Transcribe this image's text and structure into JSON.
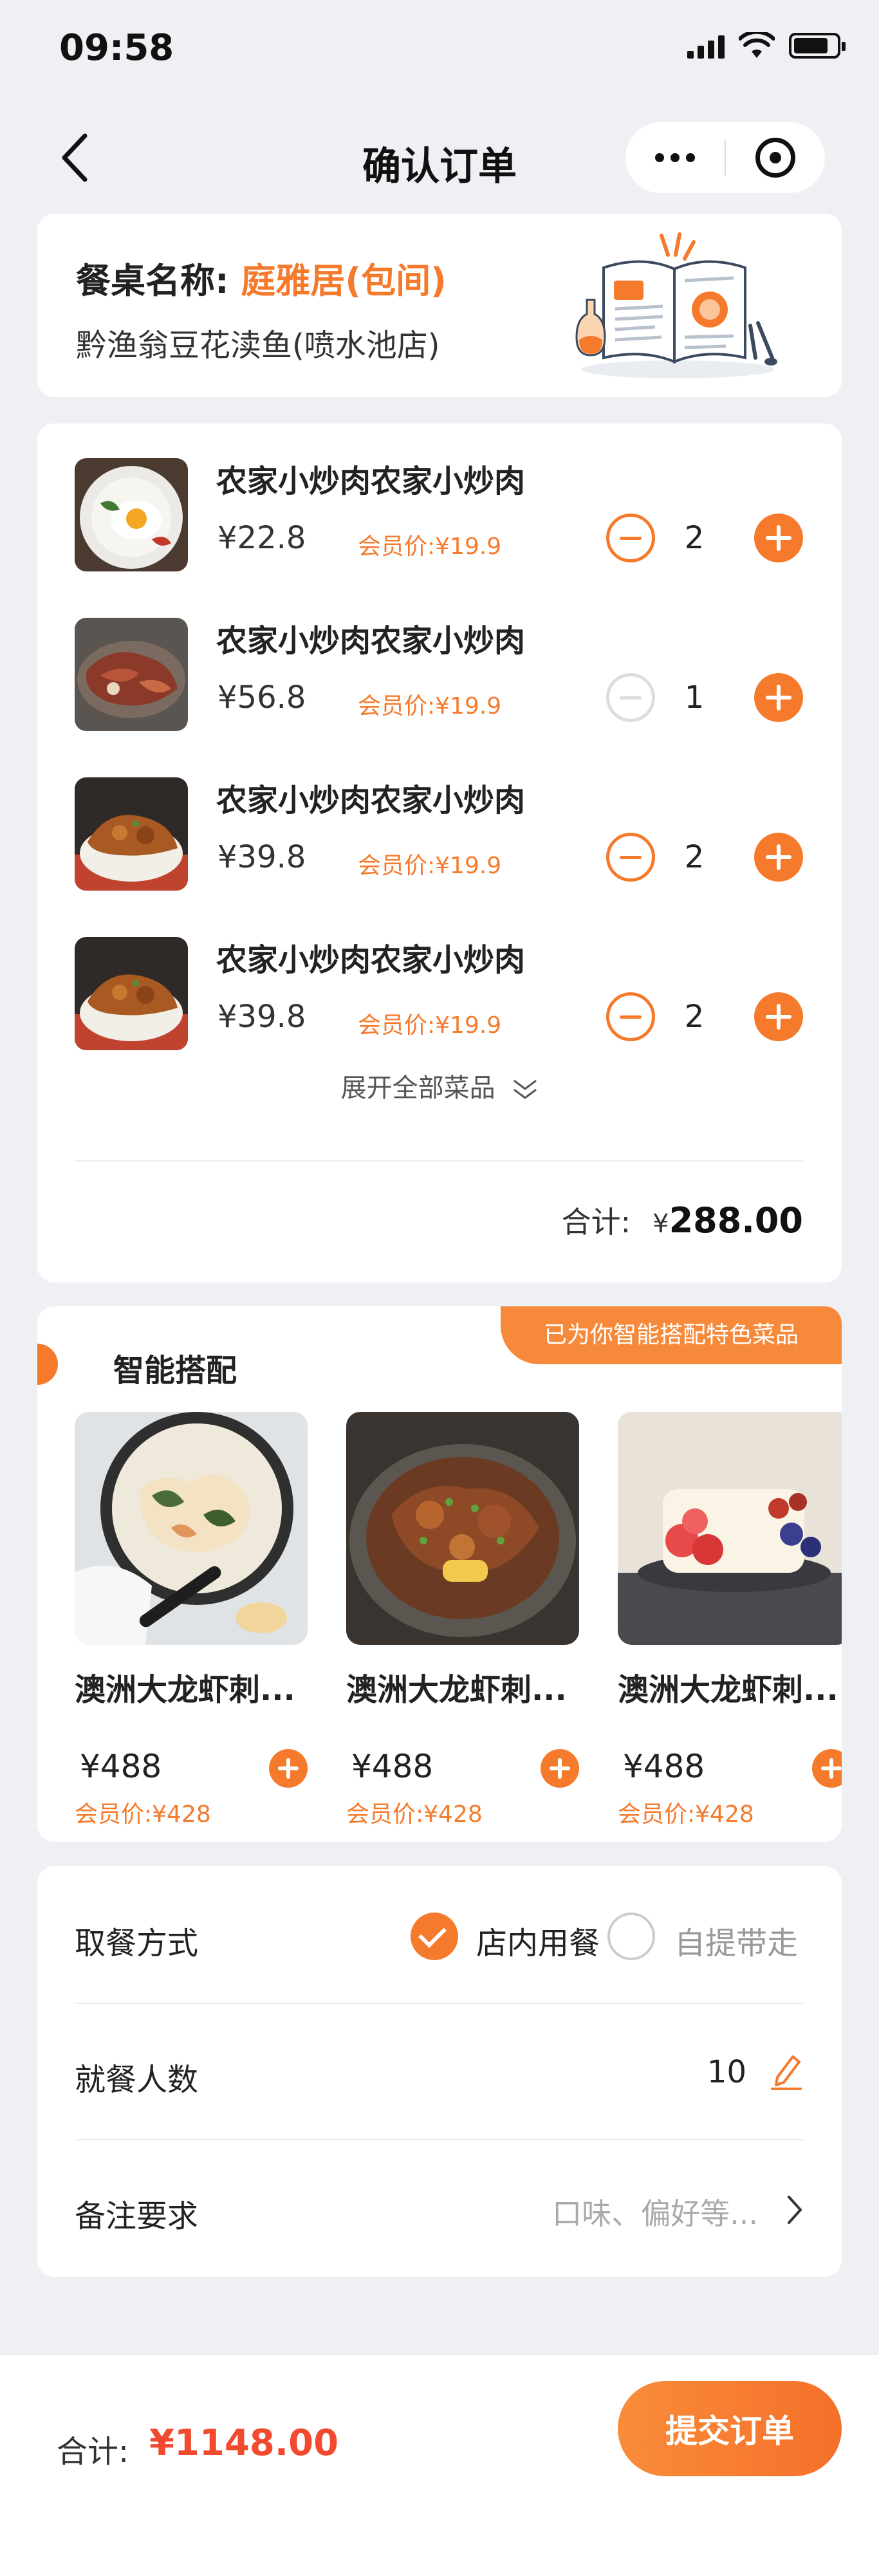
{
  "status_bar": {
    "time": "09:58"
  },
  "nav": {
    "title": "确认订单",
    "back_icon": "chevron-left-icon",
    "more_icon": "more-dots-icon",
    "close_icon": "target-circle-icon"
  },
  "table": {
    "label": "餐桌名称:",
    "name": "庭雅居(包间)",
    "store": "黔渔翁豆花渎鱼(喷水池店)"
  },
  "order": {
    "items": [
      {
        "name": "农家小炒肉农家小炒肉",
        "price": "¥22.8",
        "member_price": "会员价:¥19.9",
        "qty": "2",
        "minus_enabled": true
      },
      {
        "name": "农家小炒肉农家小炒肉",
        "price": "¥56.8",
        "member_price": "会员价:¥19.9",
        "qty": "1",
        "minus_enabled": false
      },
      {
        "name": "农家小炒肉农家小炒肉",
        "price": "¥39.8",
        "member_price": "会员价:¥19.9",
        "qty": "2",
        "minus_enabled": true
      },
      {
        "name": "农家小炒肉农家小炒肉",
        "price": "¥39.8",
        "member_price": "会员价:¥19.9",
        "qty": "2",
        "minus_enabled": true
      }
    ],
    "expand_label": "展开全部菜品",
    "subtotal_label": "合计:",
    "subtotal_currency": "¥",
    "subtotal_amount": "288.00"
  },
  "smart": {
    "title": "智能搭配",
    "tag": "已为你智能搭配特色菜品",
    "items": [
      {
        "name": "澳洲大龙虾刺...",
        "price": "¥488",
        "member_price": "会员价:¥428"
      },
      {
        "name": "澳洲大龙虾刺...",
        "price": "¥488",
        "member_price": "会员价:¥428"
      },
      {
        "name": "澳洲大龙虾刺...",
        "price": "¥488",
        "member_price": "会员价:¥428"
      }
    ]
  },
  "options": {
    "pickup_label": "取餐方式",
    "dine_in": "店内用餐",
    "takeaway": "自提带走",
    "selected": "dine_in",
    "diners_label": "就餐人数",
    "diners_value": "10",
    "remark_label": "备注要求",
    "remark_placeholder": "口味、偏好等..."
  },
  "footer": {
    "total_label": "合计:",
    "total_amount": "¥1148.00",
    "submit_label": "提交订单"
  },
  "colors": {
    "accent": "#f57a2c",
    "price_red": "#f24a2f",
    "background": "#eef0f3"
  }
}
